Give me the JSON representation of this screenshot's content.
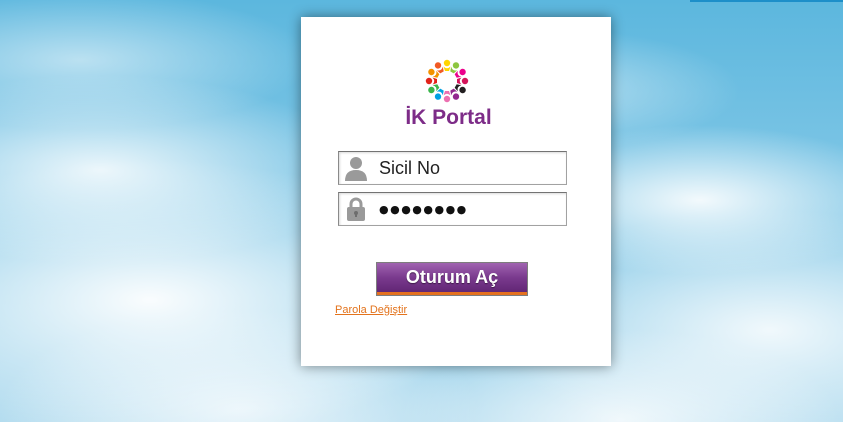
{
  "app": {
    "logo_text": "İK Portal"
  },
  "login": {
    "username_placeholder": "Sicil No",
    "password_mask": "●●●●●●●●",
    "submit_label": "Oturum Aç",
    "change_password_link": "Parola Değiştir"
  },
  "icons": {
    "logo": "people-ring-logo-icon",
    "username": "user-icon",
    "password": "lock-icon"
  },
  "colors": {
    "brand_purple": "#7d2c88",
    "button_purple": "#7a3a8e",
    "link_orange": "#e3731c",
    "button_accent_orange": "#e4711f",
    "sky_blue": "#5cb7de"
  }
}
